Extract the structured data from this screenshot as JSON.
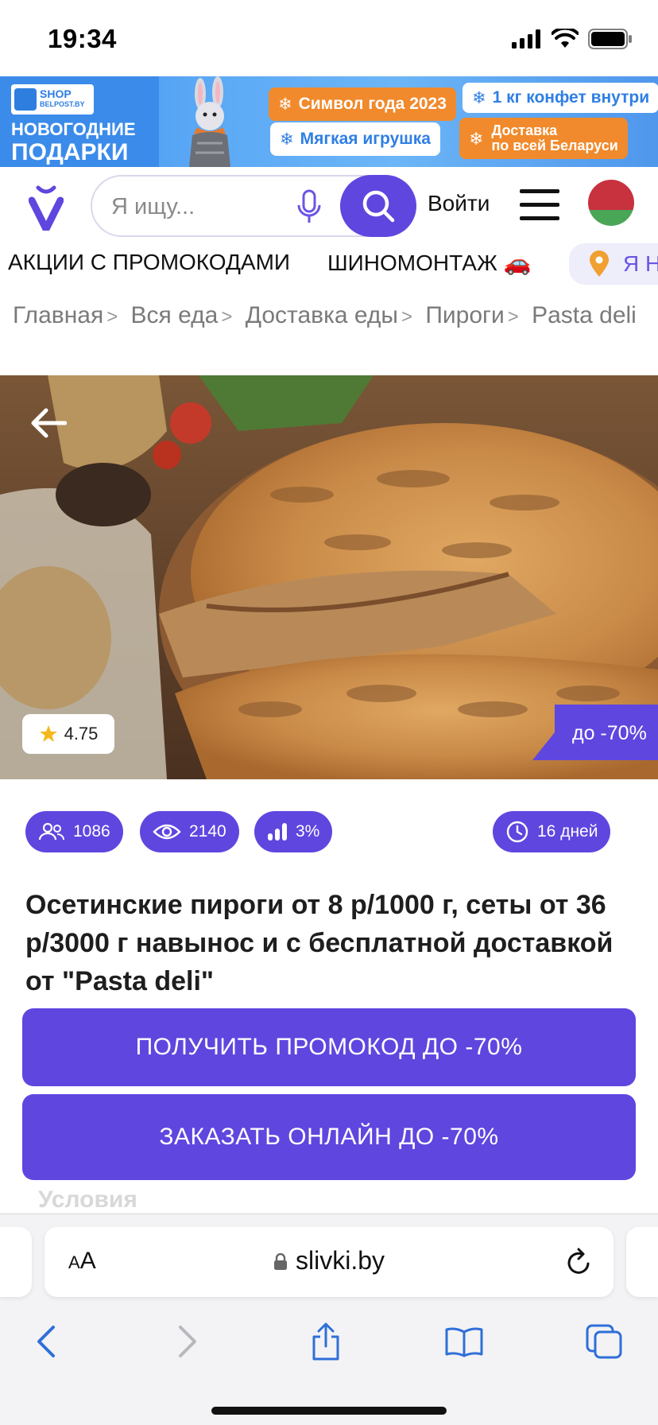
{
  "status_bar": {
    "time": "19:34"
  },
  "banner": {
    "shop_logo_line1": "SHOP",
    "shop_logo_line2": "BELPOST.BY",
    "title_line1": "НОВОГОДНИЕ",
    "title_line2": "ПОДАРКИ",
    "tag_symbol": "Символ года 2023",
    "tag_candy": "1 кг конфет внутри",
    "tag_toy": "Мягкая игрушка",
    "tag_delivery_line1": "Доставка",
    "tag_delivery_line2": "по всей Беларуси"
  },
  "header": {
    "search_placeholder": "Я ищу...",
    "login_label": "Войти"
  },
  "categories": [
    {
      "label": "АКЦИИ С ПРОМОКОДАМИ"
    },
    {
      "label": "ШИНОМОНТАЖ 🚗"
    },
    {
      "label": "Я Н"
    }
  ],
  "breadcrumbs": [
    "Главная",
    "Вся еда",
    "Доставка еды",
    "Пироги",
    "Pasta deli"
  ],
  "hero": {
    "rating": "4.75",
    "discount": "до -70%"
  },
  "stats": {
    "buyers": "1086",
    "views": "2140",
    "growth": "3%",
    "days_left": "16 дней"
  },
  "offer": {
    "title": "Осетинские пироги от 8 р/1000 г, сеты от 36 р/3000 г навынос и с бесплатной доставкой от \"Pasta deli\"",
    "cta_promo": "ПОЛУЧИТЬ ПРОМОКОД ДО -70%",
    "cta_order": "ЗАКАЗАТЬ ОНЛАЙН ДО -70%",
    "conditions_label": "Условия"
  },
  "browser": {
    "text_size_label": "AA",
    "url": "slivki.by"
  },
  "colors": {
    "brand": "#5f46df",
    "banner_blue": "#3f8ff0",
    "banner_orange": "#f08a2c"
  }
}
